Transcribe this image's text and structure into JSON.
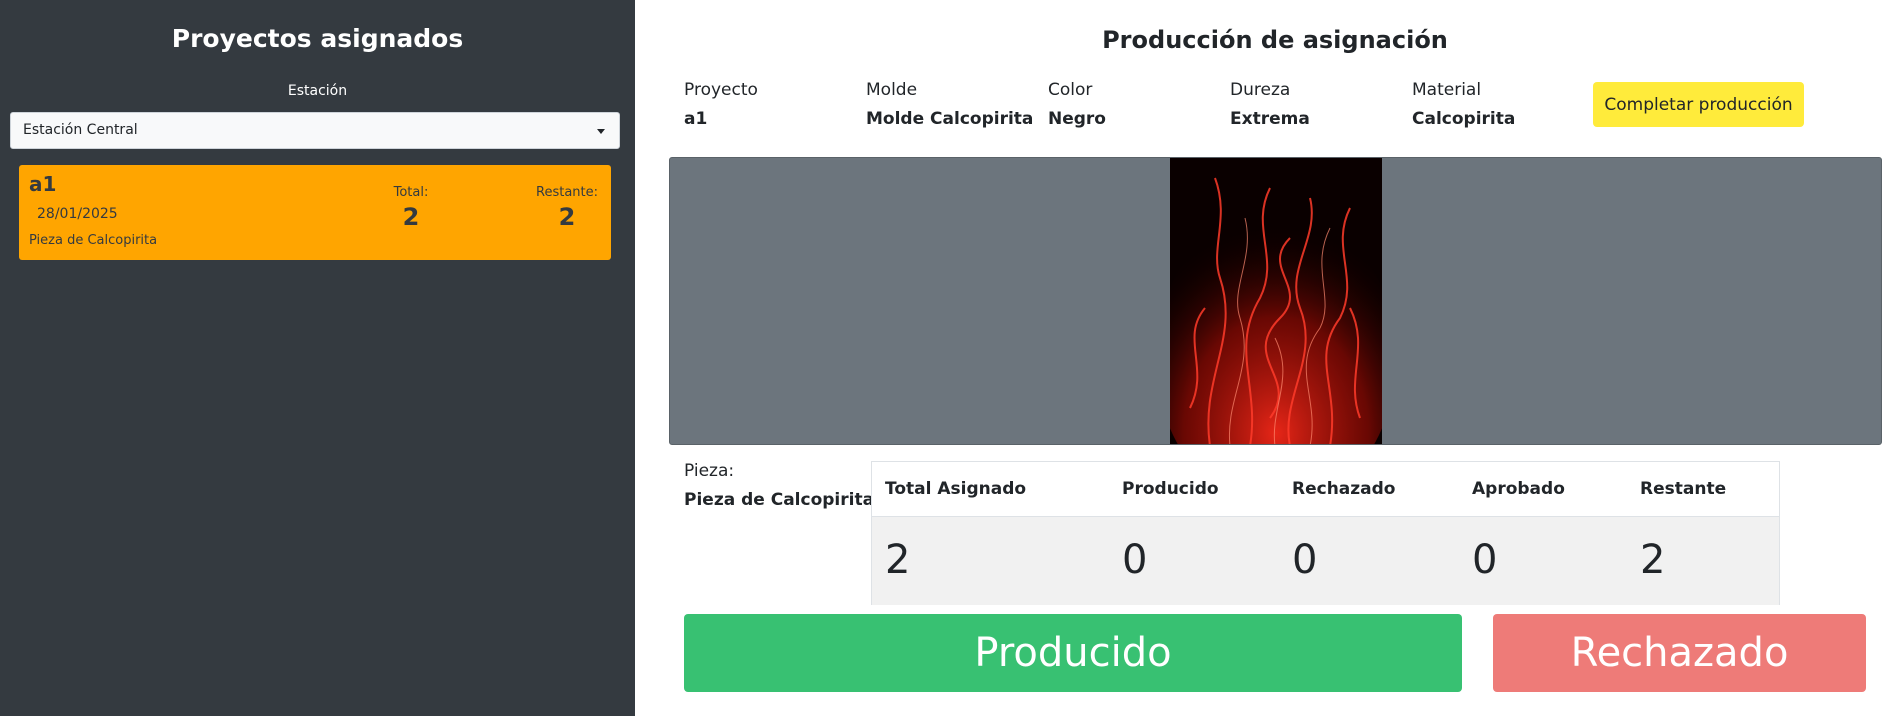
{
  "sidebar": {
    "title": "Proyectos asignados",
    "station_label": "Estación",
    "station_selected": "Estación Central",
    "project_card": {
      "name": "a1",
      "date": "28/01/2025",
      "piece": "Pieza de Calcopirita",
      "total_label": "Total:",
      "total_value": "2",
      "remaining_label": "Restante:",
      "remaining_value": "2",
      "color": "#ffa500"
    }
  },
  "main": {
    "title": "Producción de asignación",
    "info": [
      {
        "label": "Proyecto",
        "value": "a1"
      },
      {
        "label": "Molde",
        "value": "Molde Calcopirita"
      },
      {
        "label": "Color",
        "value": "Negro"
      },
      {
        "label": "Dureza",
        "value": "Extrema"
      },
      {
        "label": "Material",
        "value": "Calcopirita"
      }
    ],
    "complete_button": "Completar producción",
    "piece_label": "Pieza:",
    "piece_value": "Pieza de Calcopirita",
    "table": {
      "headers": [
        "Total Asignado",
        "Producido",
        "Rechazado",
        "Aprobado",
        "Restante"
      ],
      "values": [
        "2",
        "0",
        "0",
        "0",
        "2"
      ]
    },
    "produced_button": "Producido",
    "rejected_button": "Rechazado"
  },
  "colors": {
    "sidebar_bg": "#343a40",
    "accent_yellow": "#ffeb3b",
    "success": "#38c172",
    "danger": "#ee7b78",
    "image_bg": "#6c757d"
  },
  "icons": [
    "caret-down-icon",
    "flame-image"
  ]
}
